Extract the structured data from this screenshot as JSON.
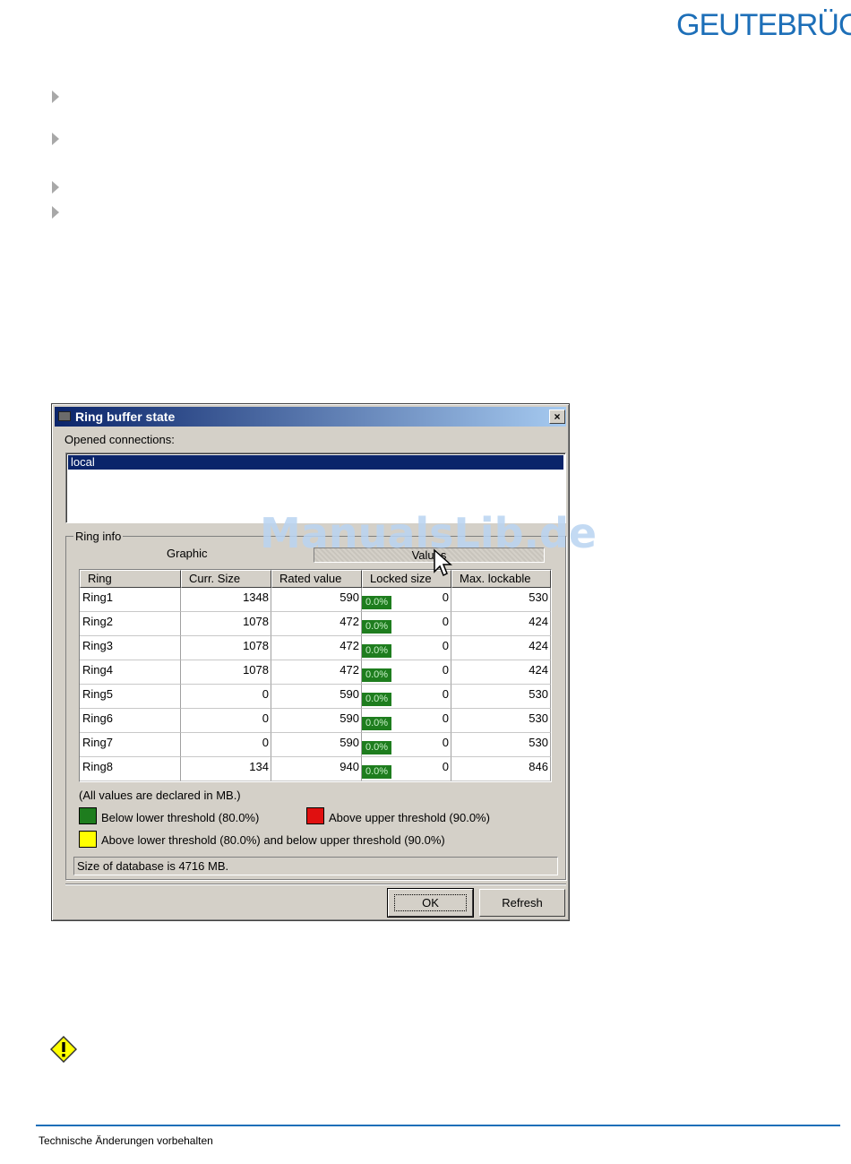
{
  "logo": {
    "text": "GEUTEBRÜCK",
    "color": "#1d6fb8"
  },
  "dialog": {
    "title": "Ring buffer state",
    "close_label": "×",
    "connections_label": "Opened connections:",
    "connections": [
      "local"
    ],
    "group_label": "Ring info",
    "tabs": [
      "Graphic",
      "Values"
    ],
    "columns": [
      "Ring",
      "Curr. Size",
      "Rated value",
      "Locked size",
      "Max. lockable"
    ],
    "rows": [
      {
        "ring": "Ring1",
        "curr": "1348",
        "rated": "590",
        "locked_pct": "0.0%",
        "locked": "0",
        "max": "530"
      },
      {
        "ring": "Ring2",
        "curr": "1078",
        "rated": "472",
        "locked_pct": "0.0%",
        "locked": "0",
        "max": "424"
      },
      {
        "ring": "Ring3",
        "curr": "1078",
        "rated": "472",
        "locked_pct": "0.0%",
        "locked": "0",
        "max": "424"
      },
      {
        "ring": "Ring4",
        "curr": "1078",
        "rated": "472",
        "locked_pct": "0.0%",
        "locked": "0",
        "max": "424"
      },
      {
        "ring": "Ring5",
        "curr": "0",
        "rated": "590",
        "locked_pct": "0.0%",
        "locked": "0",
        "max": "530"
      },
      {
        "ring": "Ring6",
        "curr": "0",
        "rated": "590",
        "locked_pct": "0.0%",
        "locked": "0",
        "max": "530"
      },
      {
        "ring": "Ring7",
        "curr": "0",
        "rated": "590",
        "locked_pct": "0.0%",
        "locked": "0",
        "max": "530"
      },
      {
        "ring": "Ring8",
        "curr": "134",
        "rated": "940",
        "locked_pct": "0.0%",
        "locked": "0",
        "max": "846"
      }
    ],
    "units_note": "(All values are declared in MB.)",
    "legend": {
      "green": {
        "label": "Below lower threshold (80.0%)",
        "color": "#1e7d1e"
      },
      "red": {
        "label": "Above upper threshold (90.0%)",
        "color": "#e01010"
      },
      "yellow": {
        "label": "Above lower threshold (80.0%) and below upper threshold (90.0%)",
        "color": "#ffff00"
      }
    },
    "status": "Size of database is 4716 MB.",
    "ok_label": "OK",
    "refresh_label": "Refresh"
  },
  "watermark": "ManualsLib.de",
  "footer": {
    "text": "Technische Änderungen vorbehalten"
  }
}
